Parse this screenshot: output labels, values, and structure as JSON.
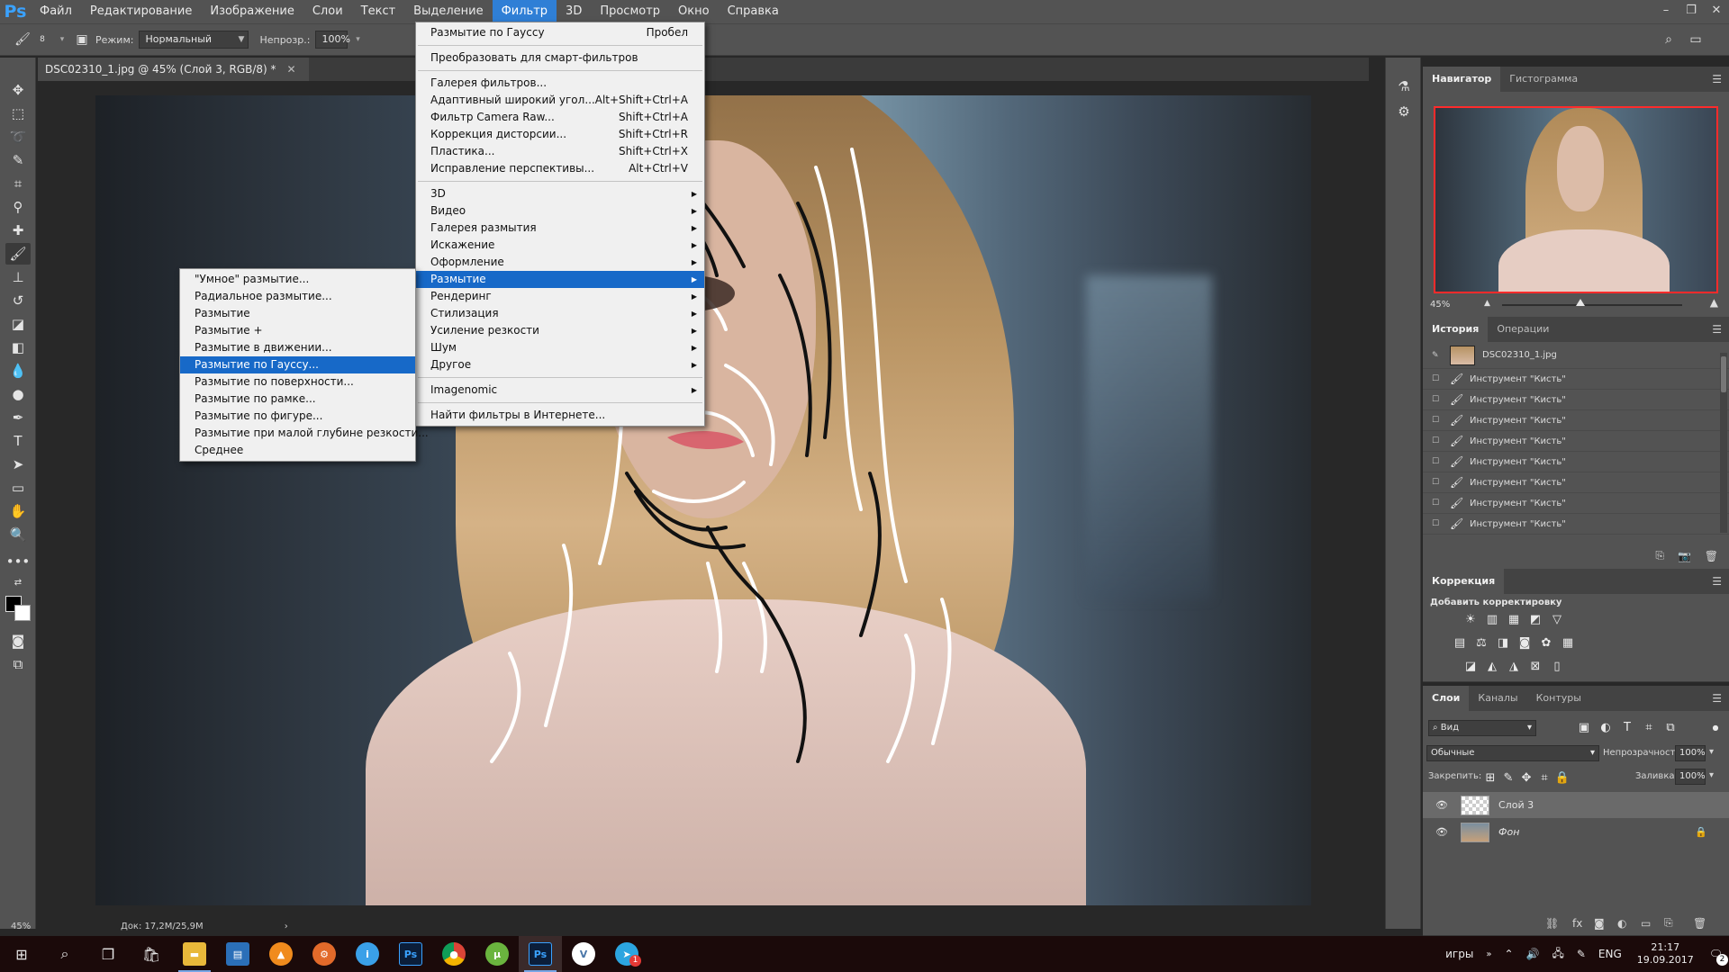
{
  "app": {
    "logo": "Ps"
  },
  "menubar": {
    "items": [
      "Файл",
      "Редактирование",
      "Изображение",
      "Слои",
      "Текст",
      "Выделение",
      "Фильтр",
      "3D",
      "Просмотр",
      "Окно",
      "Справка"
    ],
    "active": "Фильтр"
  },
  "window_controls": {
    "minimize": "–",
    "restore": "❐",
    "close": "✕"
  },
  "options_bar": {
    "brush_size": "8",
    "mode_label": "Режим:",
    "mode_value": "Нормальный",
    "opacity_label": "Непрозр.:",
    "opacity_value": "100%"
  },
  "document": {
    "tab_title": "DSC02310_1.jpg @ 45% (Слой 3, RGB/8) *",
    "close_glyph": "✕"
  },
  "status_bar": {
    "zoom": "45%",
    "doc_info": "Док: 17,2M/25,9M",
    "arrow": "›"
  },
  "filter_menu": {
    "items": [
      {
        "label": "Размытие по Гауссу",
        "shortcut": "Пробел"
      },
      {
        "separator": true
      },
      {
        "label": "Преобразовать для смарт-фильтров"
      },
      {
        "separator": true
      },
      {
        "label": "Галерея фильтров..."
      },
      {
        "label": "Адаптивный широкий угол...",
        "shortcut": "Alt+Shift+Ctrl+A"
      },
      {
        "label": "Фильтр Camera Raw...",
        "shortcut": "Shift+Ctrl+A"
      },
      {
        "label": "Коррекция дисторсии...",
        "shortcut": "Shift+Ctrl+R"
      },
      {
        "label": "Пластика...",
        "shortcut": "Shift+Ctrl+X"
      },
      {
        "label": "Исправление перспективы...",
        "shortcut": "Alt+Ctrl+V"
      },
      {
        "separator": true
      },
      {
        "label": "3D",
        "submenu": true
      },
      {
        "label": "Видео",
        "submenu": true
      },
      {
        "label": "Галерея размытия",
        "submenu": true
      },
      {
        "label": "Искажение",
        "submenu": true
      },
      {
        "label": "Оформление",
        "submenu": true
      },
      {
        "label": "Размытие",
        "submenu": true,
        "highlight": true
      },
      {
        "label": "Рендеринг",
        "submenu": true
      },
      {
        "label": "Стилизация",
        "submenu": true
      },
      {
        "label": "Усиление резкости",
        "submenu": true
      },
      {
        "label": "Шум",
        "submenu": true
      },
      {
        "label": "Другое",
        "submenu": true
      },
      {
        "separator": true
      },
      {
        "label": "Imagenomic",
        "submenu": true
      },
      {
        "separator": true
      },
      {
        "label": "Найти фильтры в Интернете..."
      }
    ]
  },
  "blur_submenu": {
    "items": [
      {
        "label": "\"Умное\" размытие..."
      },
      {
        "label": "Радиальное размытие..."
      },
      {
        "label": "Размытие"
      },
      {
        "label": "Размытие +"
      },
      {
        "label": "Размытие в движении..."
      },
      {
        "label": "Размытие по Гауссу...",
        "highlight": true
      },
      {
        "label": "Размытие по поверхности..."
      },
      {
        "label": "Размытие по рамке..."
      },
      {
        "label": "Размытие по фигуре..."
      },
      {
        "label": "Размытие при малой глубине резкости..."
      },
      {
        "label": "Среднее"
      }
    ]
  },
  "navigator": {
    "tabs": [
      "Навигатор",
      "Гистограмма"
    ],
    "zoom": "45%"
  },
  "history": {
    "tabs": [
      "История",
      "Операции"
    ],
    "snapshot": "DSC02310_1.jpg",
    "steps": [
      "Инструмент \"Кисть\"",
      "Инструмент \"Кисть\"",
      "Инструмент \"Кисть\"",
      "Инструмент \"Кисть\"",
      "Инструмент \"Кисть\"",
      "Инструмент \"Кисть\"",
      "Инструмент \"Кисть\"",
      "Инструмент \"Кисть\""
    ]
  },
  "correction": {
    "tab": "Коррекция",
    "title": "Добавить корректировку"
  },
  "layers": {
    "tabs": [
      "Слои",
      "Каналы",
      "Контуры"
    ],
    "filter_value": "Вид",
    "blend_mode": "Обычные",
    "opacity_label": "Непрозрачность:",
    "opacity_value": "100%",
    "lock_label": "Закрепить:",
    "fill_label": "Заливка:",
    "fill_value": "100%",
    "items": [
      {
        "name": "Слой 3",
        "selected": true
      },
      {
        "name": "Фон",
        "locked": true
      }
    ]
  },
  "taskbar": {
    "apps": [
      "Ps",
      "Ps"
    ],
    "telegram_badge": "1",
    "tray_label": "игры",
    "language": "ENG",
    "time": "21:17",
    "date": "19.09.2017",
    "notifications": "2"
  }
}
